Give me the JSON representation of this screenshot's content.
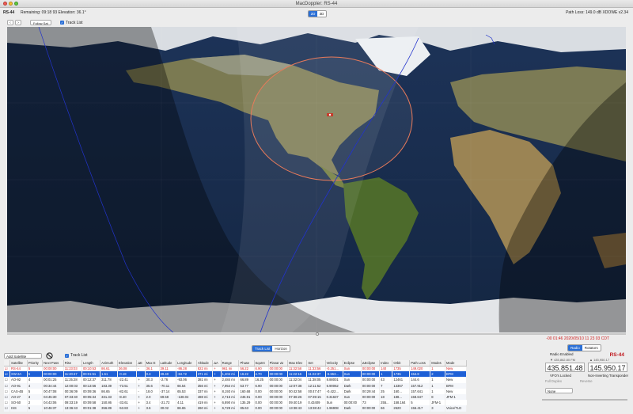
{
  "window": {
    "title": "MacDoppler: RS-44"
  },
  "status": {
    "satellite": "RS-44",
    "remaining": "Remaining: 09:18 93 Elevation: 36.1°",
    "view_modes": [
      "2D",
      "3D"
    ],
    "active_view": "2D",
    "path_loss": "Path Loss: 149.0 dB XDOWE v2.34"
  },
  "toolbar": {
    "back_label": "‹",
    "forward_label": "›",
    "follow_label": "Follow Sat",
    "track_list_label": "Track List"
  },
  "map": {
    "timestamp": "-00 01:46 2020/05/10 11 23 03 CDT",
    "footprint_color": "#e87a5a",
    "orbit_color": "#2233cc"
  },
  "bottom_tabs": [
    "Track List",
    "Horizon"
  ],
  "active_bottom_tab": "Track List",
  "track": {
    "add_satellite": "Add Satellite",
    "track_list_label": "Track List",
    "columns": [
      "",
      "Satellite",
      "Priority",
      "Next Pass",
      "Rise",
      "Length",
      "Azimuth",
      "Elevation",
      "ΔE",
      "Max E",
      "Latitude",
      "Longitude",
      "Altitude",
      "ΔA",
      "Range",
      "Phase",
      "SquInt",
      "Planar Δt",
      "Max Elev",
      "Set",
      "Velocity",
      "Eclipse",
      "ΔEclipse",
      "Index",
      "Orbit",
      "Path Loss",
      "Modes",
      "Mode"
    ],
    "rows": [
      [
        "☑",
        "RS-44",
        "5",
        "00:00:00",
        "11:23:03",
        "00:10:53",
        "86.61",
        "36.08",
        "-",
        "36.1",
        "39.11",
        "-86.28",
        "822 mi",
        "+",
        "961 mi",
        "56.22",
        "6.90",
        "00:00:00",
        "11:32:58",
        "11:33:56",
        "-0.251...",
        "Sun",
        "00:00:00",
        "140",
        "1735",
        "149.020",
        "1",
        "New"
      ],
      [
        "☑",
        "XW-2A",
        "5",
        "00:00:00",
        "11:20:47",
        "00:01:51",
        "1.51",
        "-0.18",
        "-",
        "0.3",
        "39.40",
        "-84.72",
        "371 mi",
        "+",
        "1,404 mi",
        "16.22",
        "4.70",
        "00:00:00",
        "11:22:16",
        "11:22:37",
        "-6.553...",
        "Sun",
        "00:00:00",
        "1",
        "1735",
        "154.8",
        "2",
        "BFM"
      ],
      [
        "☐",
        "AO-92",
        "4",
        "00:01:25",
        "11:25:28",
        "00:12:37",
        "311.78",
        "-22.41",
        "+",
        "30.3",
        "-2.76",
        "-93.06",
        "381 mi",
        "+",
        "2,484 mi",
        "66.89",
        "16.25",
        "00:00:00",
        "11:32:04",
        "11:38:05",
        "8.88001",
        "Sun",
        "00:00:00",
        "43",
        "12461",
        "144.6",
        "1",
        "New"
      ],
      [
        "☐",
        "AO-91",
        "4",
        "00:34:44",
        "12:00:03",
        "00:13:56",
        "183.39",
        "-73.51",
        "+",
        "35.6",
        "-70.11",
        "66.54",
        "356 mi",
        "+",
        "7,954 mi",
        "53.77",
        "6.90",
        "00:00:00",
        "12:07:38",
        "12:11:52",
        "6.90062",
        "Dark",
        "00:00:00",
        "7",
        "13367",
        "157.912",
        "1",
        "BFM"
      ],
      [
        "☐",
        "CAS-4B",
        "5",
        "00:47:08",
        "00:36:09",
        "00:09:36",
        "86.65",
        "-82.61",
        "-",
        "18.0",
        "-37.14",
        "65.53",
        "337 mi",
        "+",
        "8,193 mi",
        "160.68",
        "0.00",
        "00:00:00",
        "00:42:58",
        "00:47:47",
        "-0.422...",
        "Dark",
        "00:29:44",
        "25",
        "160...",
        "157.641",
        "1",
        "New"
      ],
      [
        "☐",
        "AO-27",
        "3",
        "04:45:30",
        "07:33:40",
        "00:05:34",
        "331.33",
        "-8.40",
        "+",
        "2.0",
        "69.58",
        "-138.04",
        "488 mi",
        "+",
        "2,715 mi",
        "246.91",
        "0.00",
        "00:00:00",
        "07:36:26",
        "07:39:15",
        "0.31637",
        "Sun",
        "00:00:00",
        "18",
        "188...",
        "158.647",
        "8",
        "JFM-1"
      ],
      [
        "☐",
        "SO-50",
        "2",
        "04:43:06",
        "09:33:19",
        "00:09:58",
        "150.86",
        "-33.61",
        "+",
        "3.4",
        "-21.72",
        "4.11",
        "419 mi",
        "+",
        "6,890 mi",
        "135.29",
        "0.00",
        "00:00:00",
        "09:40:19",
        "0.43409",
        "Sun",
        "00:00:00",
        "73",
        "255...",
        "158.164",
        "5",
        "JFM-1"
      ],
      [
        "☐",
        "ISS",
        "5",
        "10:46:37",
        "13:36:43",
        "00:01:38",
        "356.89",
        "-53.83",
        "+",
        "3.6",
        "30.02",
        "86.65",
        "260 mi",
        "+",
        "6,729 mi",
        "85.63",
        "0.00",
        "00:00:00",
        "13:38:43",
        "13:38:42",
        "1.96908",
        "Dark",
        "00:00:00",
        "66",
        "2620",
        "156.417",
        "3",
        "Voice/TLD"
      ]
    ]
  },
  "radio": {
    "tabs": [
      "Radio",
      "Rotators"
    ],
    "active_tab": "Radio",
    "enabled_label": "Radio Enabled",
    "satellite": "RS-44",
    "downlink_sub": "▼ 435,862.80 FM",
    "uplink_sub": "▲ 145,950.17",
    "downlink": "435.851.48",
    "uplink": "145.950.17",
    "vfo_label": "VFO's Locked",
    "transponder": "Non-Inverting Transponder",
    "full_duplex": "Full Duplex",
    "reverse": "Reverse",
    "tuning_mode": "None"
  }
}
